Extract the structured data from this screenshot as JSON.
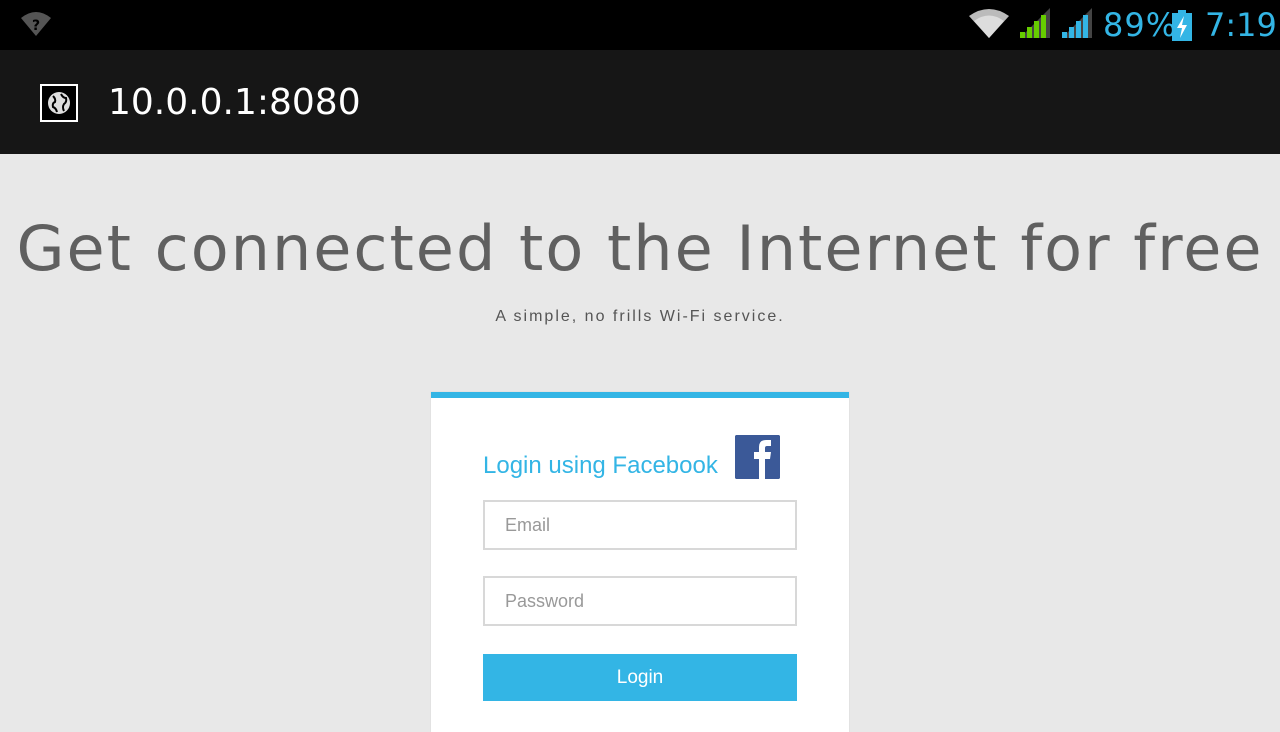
{
  "status_bar": {
    "battery_percent": "89%",
    "clock": "7:19",
    "accent_color": "#33b5e5",
    "icons": [
      "wifi-unknown-icon",
      "wifi-icon",
      "signal-icon",
      "signal-icon",
      "battery-charging-icon"
    ]
  },
  "app_bar": {
    "url": "10.0.0.1:8080",
    "icon": "globe-icon"
  },
  "page": {
    "headline": "Get connected to the Internet for free",
    "subheadline": "A simple, no frills Wi-Fi service."
  },
  "login_card": {
    "facebook_label": "Login using Facebook",
    "facebook_icon": "facebook-icon",
    "email_placeholder": "Email",
    "password_placeholder": "Password",
    "login_button": "Login",
    "accent_color": "#33b5e5",
    "facebook_color": "#3b5998"
  }
}
